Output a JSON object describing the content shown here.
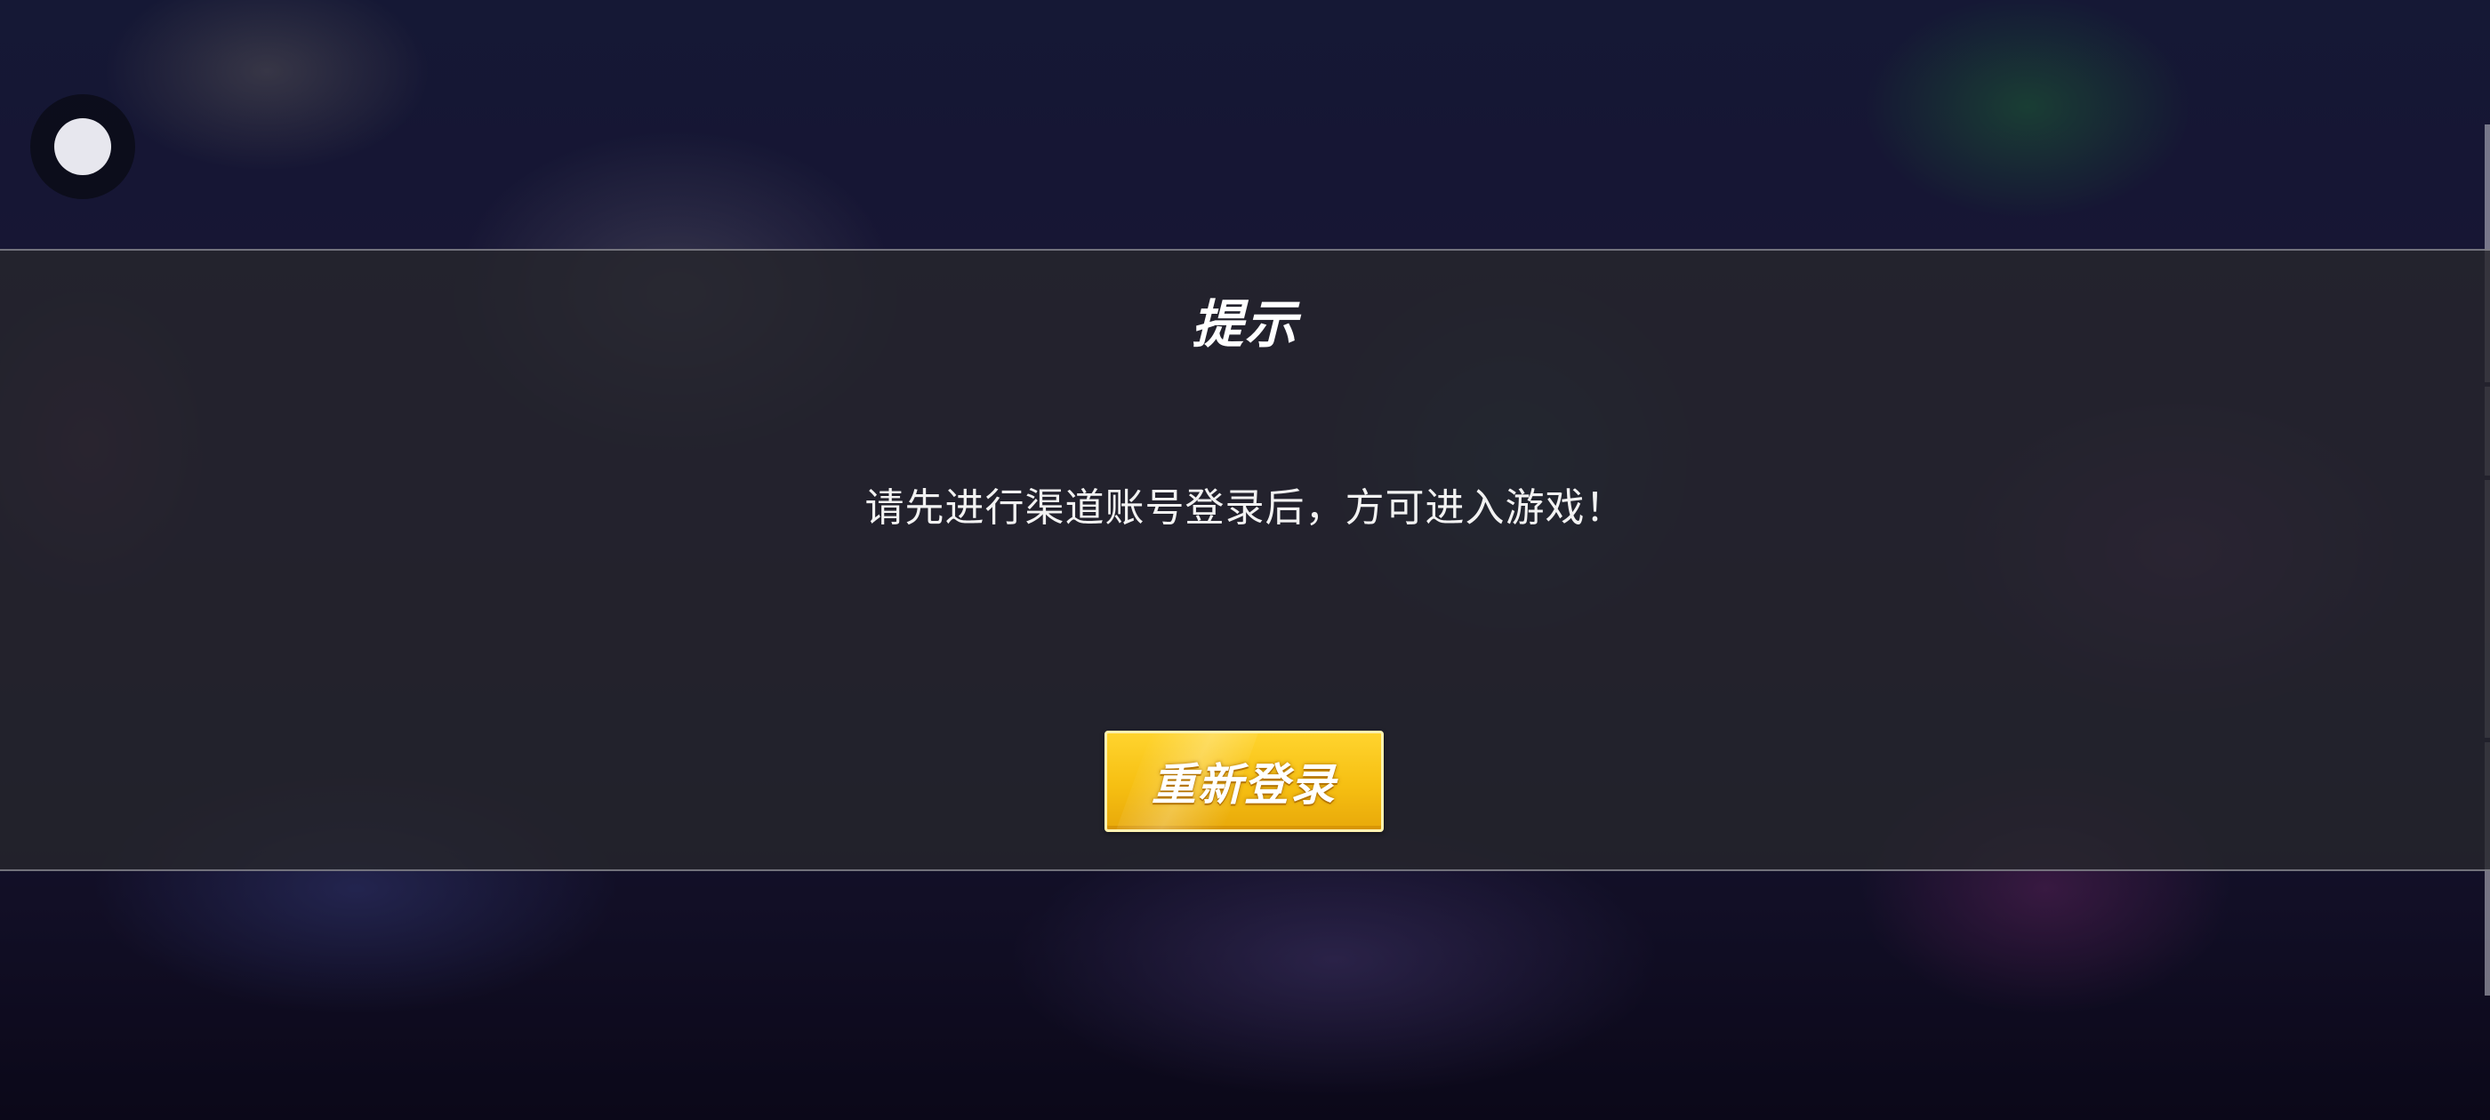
{
  "floating_ball": {
    "icon": "assistive-ball-icon"
  },
  "dialog": {
    "title": "提示",
    "message": "请先进行渠道账号登录后，方可进入游戏！",
    "button_label": "重新登录"
  },
  "colors": {
    "dialog_background": "#26262c",
    "button_yellow": "#f6bf12",
    "text_white": "#ffffff"
  }
}
